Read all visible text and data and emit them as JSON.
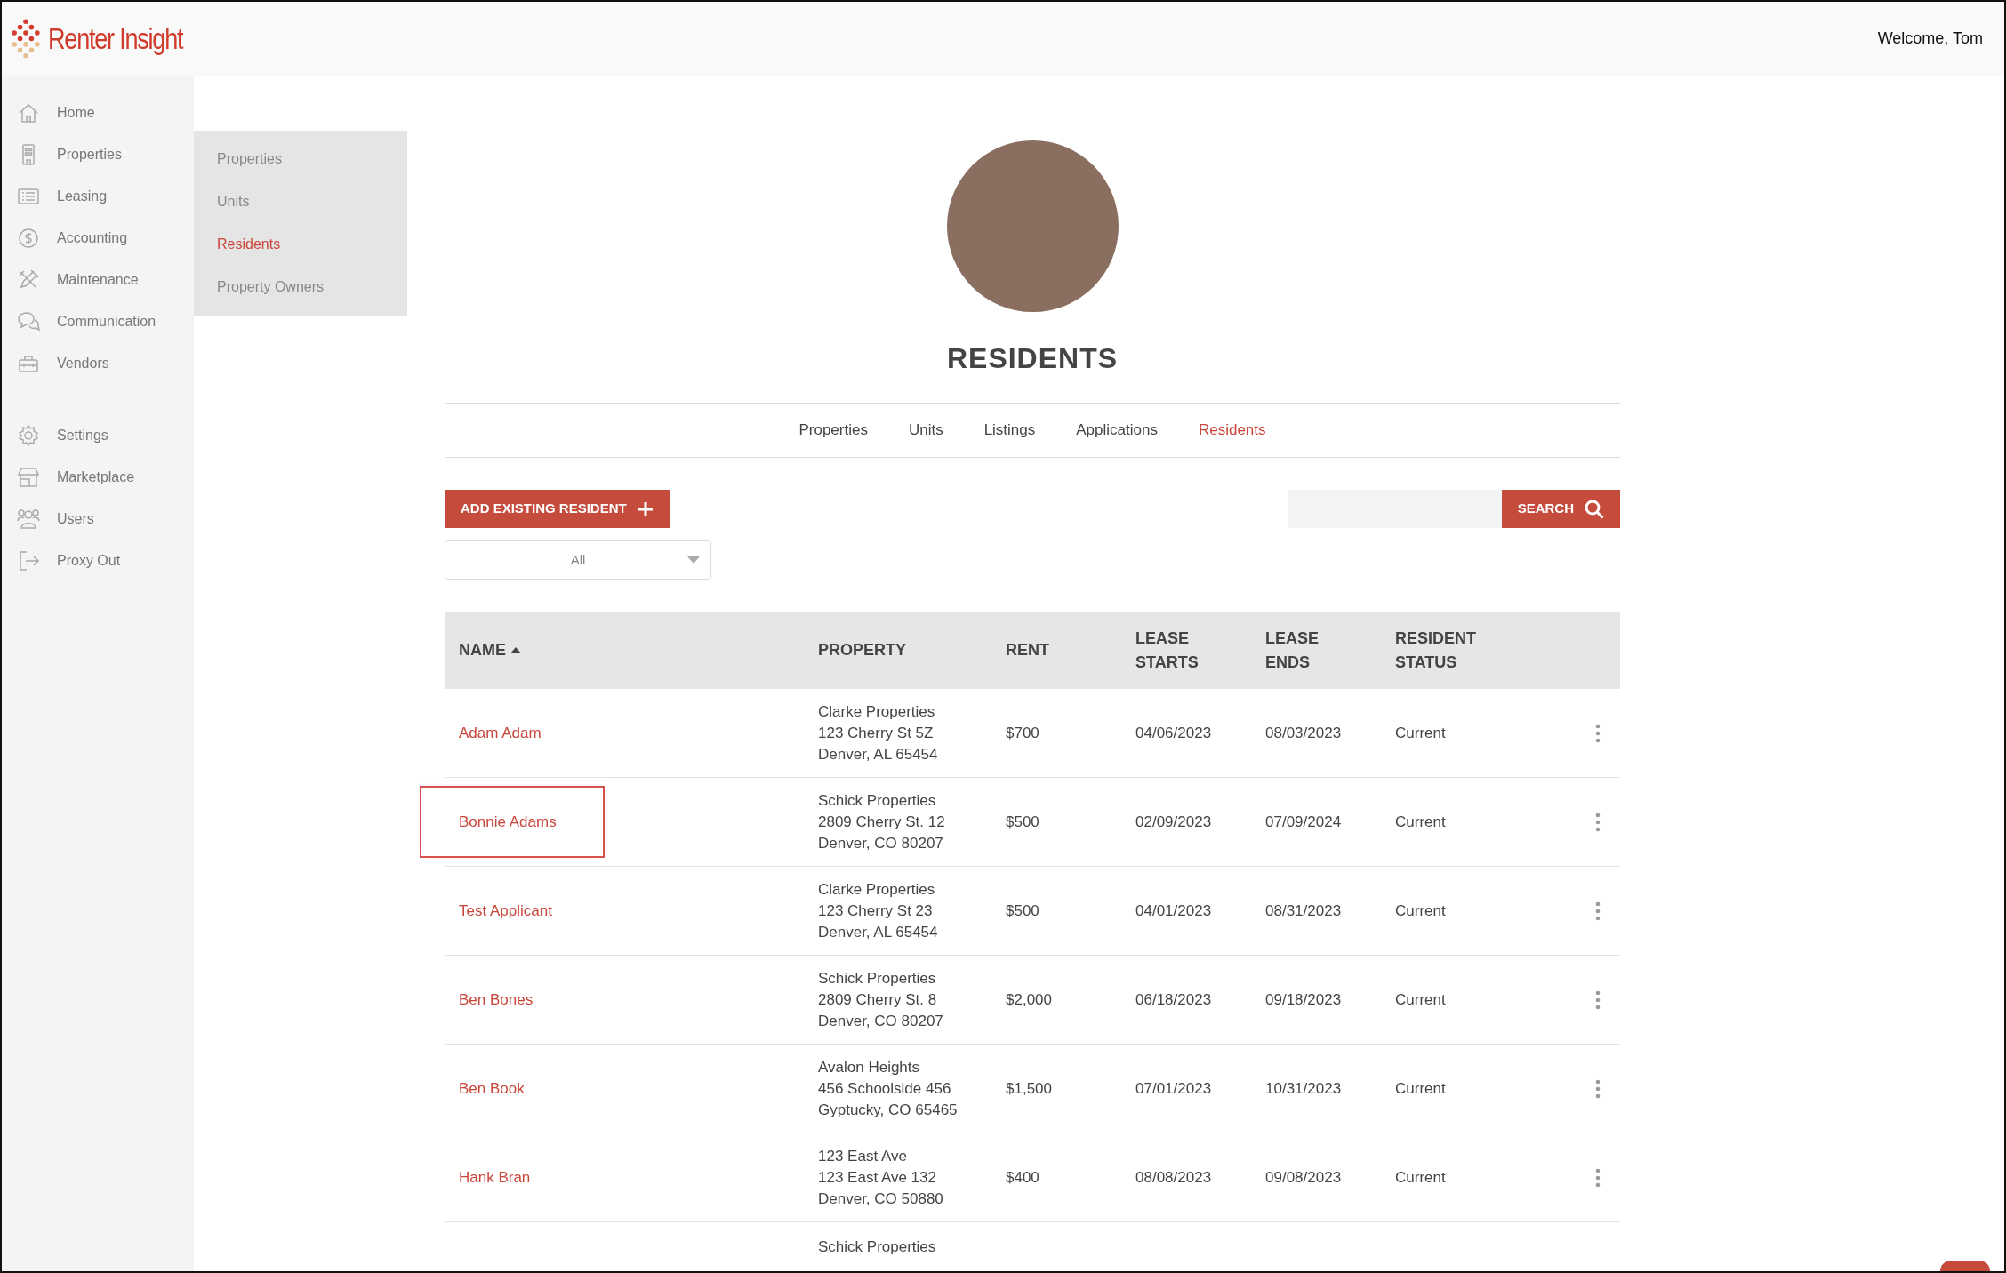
{
  "header": {
    "logo_text": "Renter Insight",
    "welcome": "Welcome, Tom"
  },
  "sidebar": {
    "groups": [
      [
        {
          "label": "Home"
        },
        {
          "label": "Properties"
        },
        {
          "label": "Leasing"
        },
        {
          "label": "Accounting"
        },
        {
          "label": "Maintenance"
        },
        {
          "label": "Communication"
        },
        {
          "label": "Vendors"
        }
      ],
      [
        {
          "label": "Settings"
        },
        {
          "label": "Marketplace"
        },
        {
          "label": "Users"
        },
        {
          "label": "Proxy Out"
        }
      ]
    ]
  },
  "submenu": [
    {
      "label": "Properties",
      "selected": false
    },
    {
      "label": "Units",
      "selected": false
    },
    {
      "label": "Residents",
      "selected": true
    },
    {
      "label": "Property Owners",
      "selected": false
    }
  ],
  "page": {
    "title": "RESIDENTS"
  },
  "tabs": [
    {
      "label": "Properties",
      "selected": false
    },
    {
      "label": "Units",
      "selected": false
    },
    {
      "label": "Listings",
      "selected": false
    },
    {
      "label": "Applications",
      "selected": false
    },
    {
      "label": "Residents",
      "selected": true
    }
  ],
  "add_button": "ADD EXISTING RESIDENT",
  "search_button": "SEARCH",
  "filter": {
    "value": "All"
  },
  "table": {
    "columns": [
      {
        "label": "NAME",
        "sorted": true
      },
      {
        "label": "PROPERTY",
        "sorted": false
      },
      {
        "label": "RENT",
        "sorted": false
      },
      {
        "label": "LEASE STARTS",
        "sorted": false
      },
      {
        "label": "LEASE ENDS",
        "sorted": false
      },
      {
        "label": "RESIDENT STATUS",
        "sorted": false
      }
    ],
    "rows": [
      {
        "name": "Adam Adam",
        "property": [
          "Clarke Properties",
          "123 Cherry St 5Z",
          "Denver, AL 65454"
        ],
        "rent": "$700",
        "lease_starts": "04/06/2023",
        "lease_ends": "08/03/2023",
        "status": "Current",
        "highlighted": false
      },
      {
        "name": "Bonnie Adams",
        "property": [
          "Schick Properties",
          "2809 Cherry St. 12",
          "Denver, CO 80207"
        ],
        "rent": "$500",
        "lease_starts": "02/09/2023",
        "lease_ends": "07/09/2024",
        "status": "Current",
        "highlighted": true
      },
      {
        "name": "Test Applicant",
        "property": [
          "Clarke Properties",
          "123 Cherry St 23",
          "Denver, AL 65454"
        ],
        "rent": "$500",
        "lease_starts": "04/01/2023",
        "lease_ends": "08/31/2023",
        "status": "Current",
        "highlighted": false
      },
      {
        "name": "Ben Bones",
        "property": [
          "Schick Properties",
          "2809 Cherry St. 8",
          "Denver, CO 80207"
        ],
        "rent": "$2,000",
        "lease_starts": "06/18/2023",
        "lease_ends": "09/18/2023",
        "status": "Current",
        "highlighted": false
      },
      {
        "name": "Ben Book",
        "property": [
          "Avalon Heights",
          "456 Schoolside 456",
          "Gyptucky, CO 65465"
        ],
        "rent": "$1,500",
        "lease_starts": "07/01/2023",
        "lease_ends": "10/31/2023",
        "status": "Current",
        "highlighted": false
      },
      {
        "name": "Hank Bran",
        "property": [
          "123 East Ave",
          "123 East Ave 132",
          "Denver, CO 50880"
        ],
        "rent": "$400",
        "lease_starts": "08/08/2023",
        "lease_ends": "09/08/2023",
        "status": "Current",
        "highlighted": false
      }
    ],
    "partial_row": {
      "property": "Schick Properties"
    }
  }
}
